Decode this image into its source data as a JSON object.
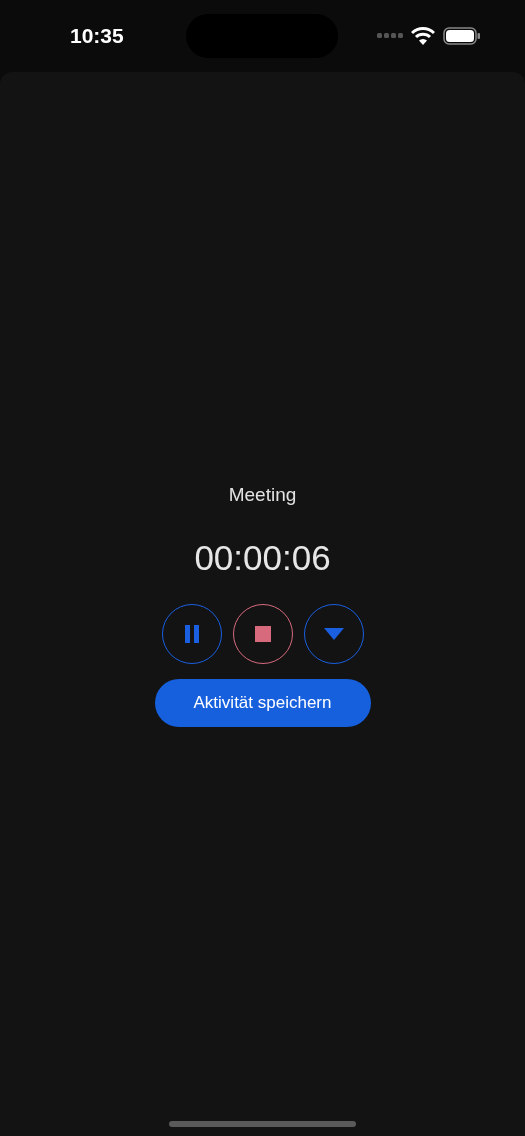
{
  "status_bar": {
    "time": "10:35"
  },
  "activity": {
    "title": "Meeting",
    "elapsed": "00:00:06"
  },
  "controls": [
    {
      "kind": "pause",
      "color": "#1a5fe0"
    },
    {
      "kind": "stop",
      "color": "#d86a7e"
    },
    {
      "kind": "dropdown",
      "color": "#1a5fe0"
    }
  ],
  "save_button": {
    "label": "Aktivität speichern"
  }
}
